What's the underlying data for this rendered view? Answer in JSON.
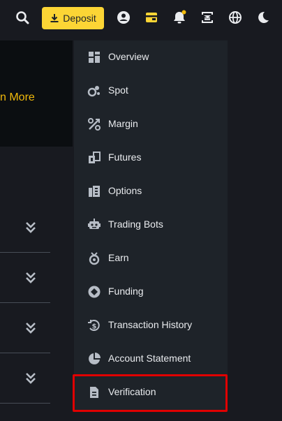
{
  "header": {
    "deposit_label": "Deposit",
    "icons": [
      "search-icon",
      "deposit-download-icon",
      "user-icon",
      "wallet-icon",
      "notification-bell-icon",
      "download-app-icon",
      "language-globe-icon",
      "dark-mode-moon-icon"
    ]
  },
  "banner": {
    "link_text": "n More"
  },
  "menu": {
    "items": [
      {
        "label": "Overview",
        "icon": "overview-icon"
      },
      {
        "label": "Spot",
        "icon": "spot-icon"
      },
      {
        "label": "Margin",
        "icon": "margin-icon"
      },
      {
        "label": "Futures",
        "icon": "futures-icon"
      },
      {
        "label": "Options",
        "icon": "options-icon"
      },
      {
        "label": "Trading Bots",
        "icon": "trading-bots-icon"
      },
      {
        "label": "Earn",
        "icon": "earn-icon"
      },
      {
        "label": "Funding",
        "icon": "funding-icon"
      },
      {
        "label": "Transaction History",
        "icon": "transaction-history-icon"
      },
      {
        "label": "Account Statement",
        "icon": "account-statement-icon"
      },
      {
        "label": "Verification",
        "icon": "verification-icon"
      }
    ]
  },
  "colors": {
    "accent": "#fcd535",
    "highlight": "#e00000",
    "menu_bg": "#1e2329",
    "page_bg": "#181a20",
    "icon": "#b7bdc6"
  }
}
